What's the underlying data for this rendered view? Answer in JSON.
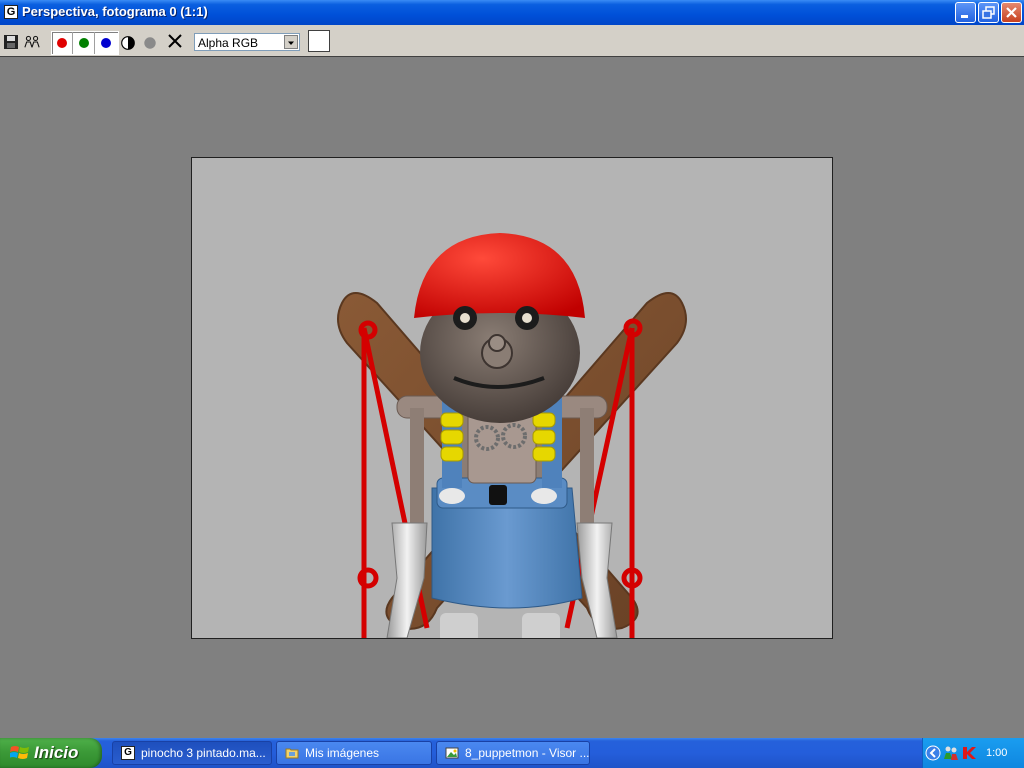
{
  "window": {
    "title": "Perspectiva, fotograma 0 (1:1)",
    "app_icon_glyph": "G"
  },
  "toolbar": {
    "channel_select": {
      "selected": "Alpha RGB"
    },
    "color_swatch": "#ffffff",
    "channel_colors": {
      "red": "#e00000",
      "green": "#008000",
      "blue": "#0000d0"
    }
  },
  "taskbar": {
    "start_label": "Inicio",
    "tasks": [
      {
        "label": "pinocho 3 pintado.ma...",
        "icon": "app-g-icon"
      },
      {
        "label": "Mis imágenes",
        "icon": "folder-icon"
      },
      {
        "label": "8_puppetmon - Visor ...",
        "icon": "image-viewer-icon"
      }
    ],
    "clock": "1:00"
  }
}
